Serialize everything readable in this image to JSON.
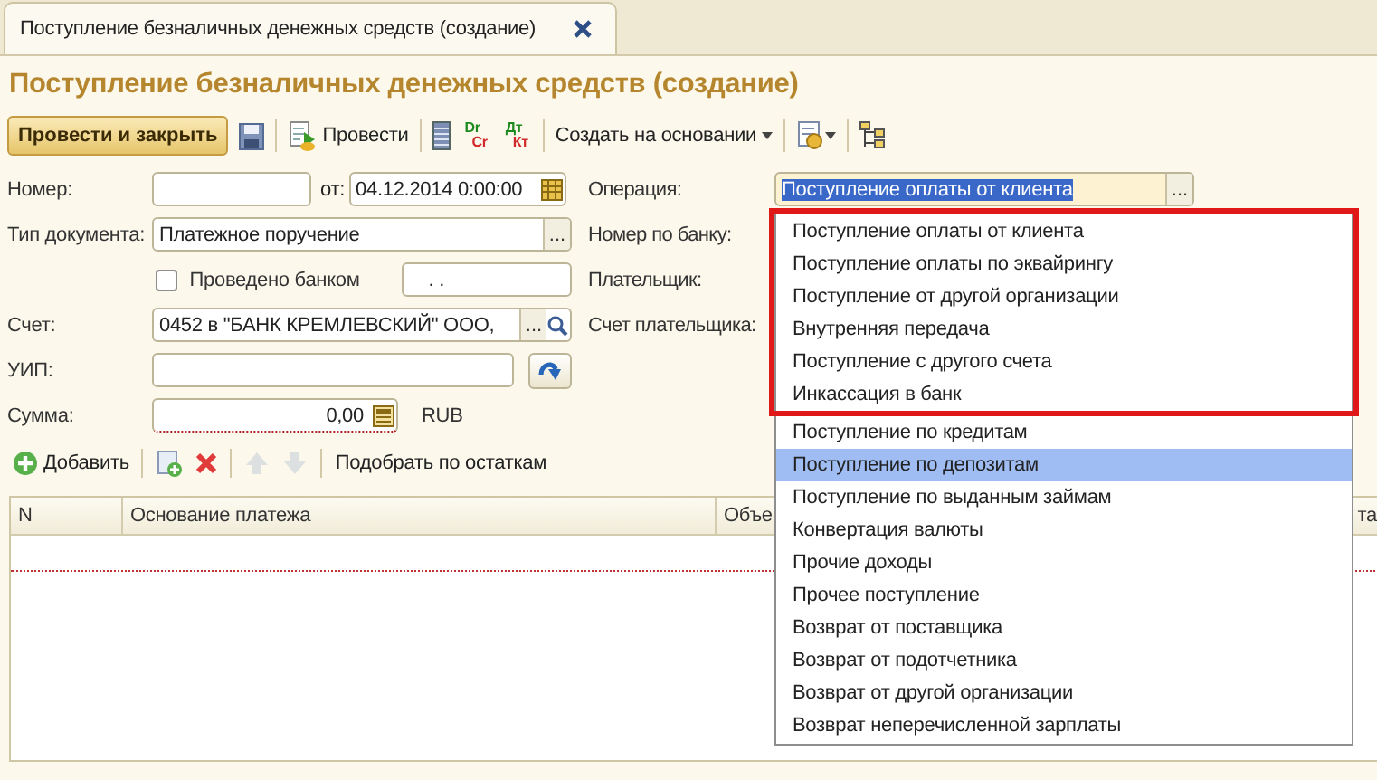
{
  "tab": {
    "title": "Поступление безналичных денежных средств (создание)"
  },
  "title": "Поступление безналичных денежных средств (создание)",
  "toolbar": [
    {
      "kind": "default-button",
      "label": "Провести и закрыть"
    },
    {
      "kind": "save"
    },
    {
      "kind": "post",
      "label": "Провести"
    },
    {
      "kind": "list"
    },
    {
      "kind": "dr-cr",
      "label": "Dr",
      "sub": "Cr"
    },
    {
      "kind": "dt-kt",
      "label": "Дт",
      "sub": "Кт"
    },
    {
      "kind": "menu",
      "label": "Создать на основании"
    },
    {
      "kind": "print-menu"
    },
    {
      "kind": "structure"
    }
  ],
  "form": {
    "number": {
      "label": "Номер:"
    },
    "date": {
      "label": "от:",
      "value": "04.12.2014  0:00:00"
    },
    "operation": {
      "label": "Операция:",
      "value": "Поступление оплаты от клиента",
      "select_button": "...",
      "expanded": true
    },
    "doc_type": {
      "label": "Тип документа:",
      "value": "Платежное поручение",
      "select_button": "..."
    },
    "bank_number": {
      "label": "Номер по банку:"
    },
    "posted_by_bank": {
      "label": "Проведено банком",
      "checked": false
    },
    "bank_date": {
      "value": ". ."
    },
    "payer": {
      "label": "Плательщик:"
    },
    "account": {
      "label": "Счет:",
      "value": "0452 в \"БАНК КРЕМЛЕВСКИЙ\" ООО,",
      "select_button": "..."
    },
    "payer_account": {
      "label": "Счет плательщика:"
    },
    "uip": {
      "label": "УИП:"
    },
    "amount": {
      "label": "Сумма:",
      "value": "0,00",
      "currency": "RUB"
    }
  },
  "table_toolbar": [
    {
      "kind": "add",
      "label": "Добавить",
      "disabled": false
    },
    {
      "kind": "copy",
      "disabled": false
    },
    {
      "kind": "delete",
      "disabled": false
    },
    {
      "kind": "up",
      "disabled": true
    },
    {
      "kind": "down",
      "disabled": true
    },
    {
      "kind": "text",
      "label": "Подобрать по остаткам",
      "disabled": false
    }
  ],
  "table": {
    "columns": [
      "N",
      "Основание платежа",
      "Объе",
      "та"
    ]
  },
  "dropdown": {
    "framed_items": [
      {
        "label": "Поступление оплаты от клиента",
        "selected": false
      },
      {
        "label": "Поступление оплаты по эквайрингу",
        "selected": false
      },
      {
        "label": "Поступление от другой организации",
        "selected": false
      },
      {
        "label": "Внутренняя передача",
        "selected": false
      },
      {
        "label": "Поступление с другого счета",
        "selected": false
      },
      {
        "label": "Инкассация в банк",
        "selected": false
      }
    ],
    "items": [
      {
        "label": "Поступление по кредитам",
        "selected": false
      },
      {
        "label": "Поступление по депозитам",
        "selected": true
      },
      {
        "label": "Поступление по выданным займам",
        "selected": false
      },
      {
        "label": "Конвертация валюты",
        "selected": false
      },
      {
        "label": "Прочие доходы",
        "selected": false
      },
      {
        "label": "Прочее поступление",
        "selected": false
      },
      {
        "label": "Возврат от поставщика",
        "selected": false
      },
      {
        "label": "Возврат от подотчетника",
        "selected": false
      },
      {
        "label": "Возврат от другой организации",
        "selected": false
      },
      {
        "label": "Возврат неперечисленной зарплаты",
        "selected": false
      }
    ]
  }
}
